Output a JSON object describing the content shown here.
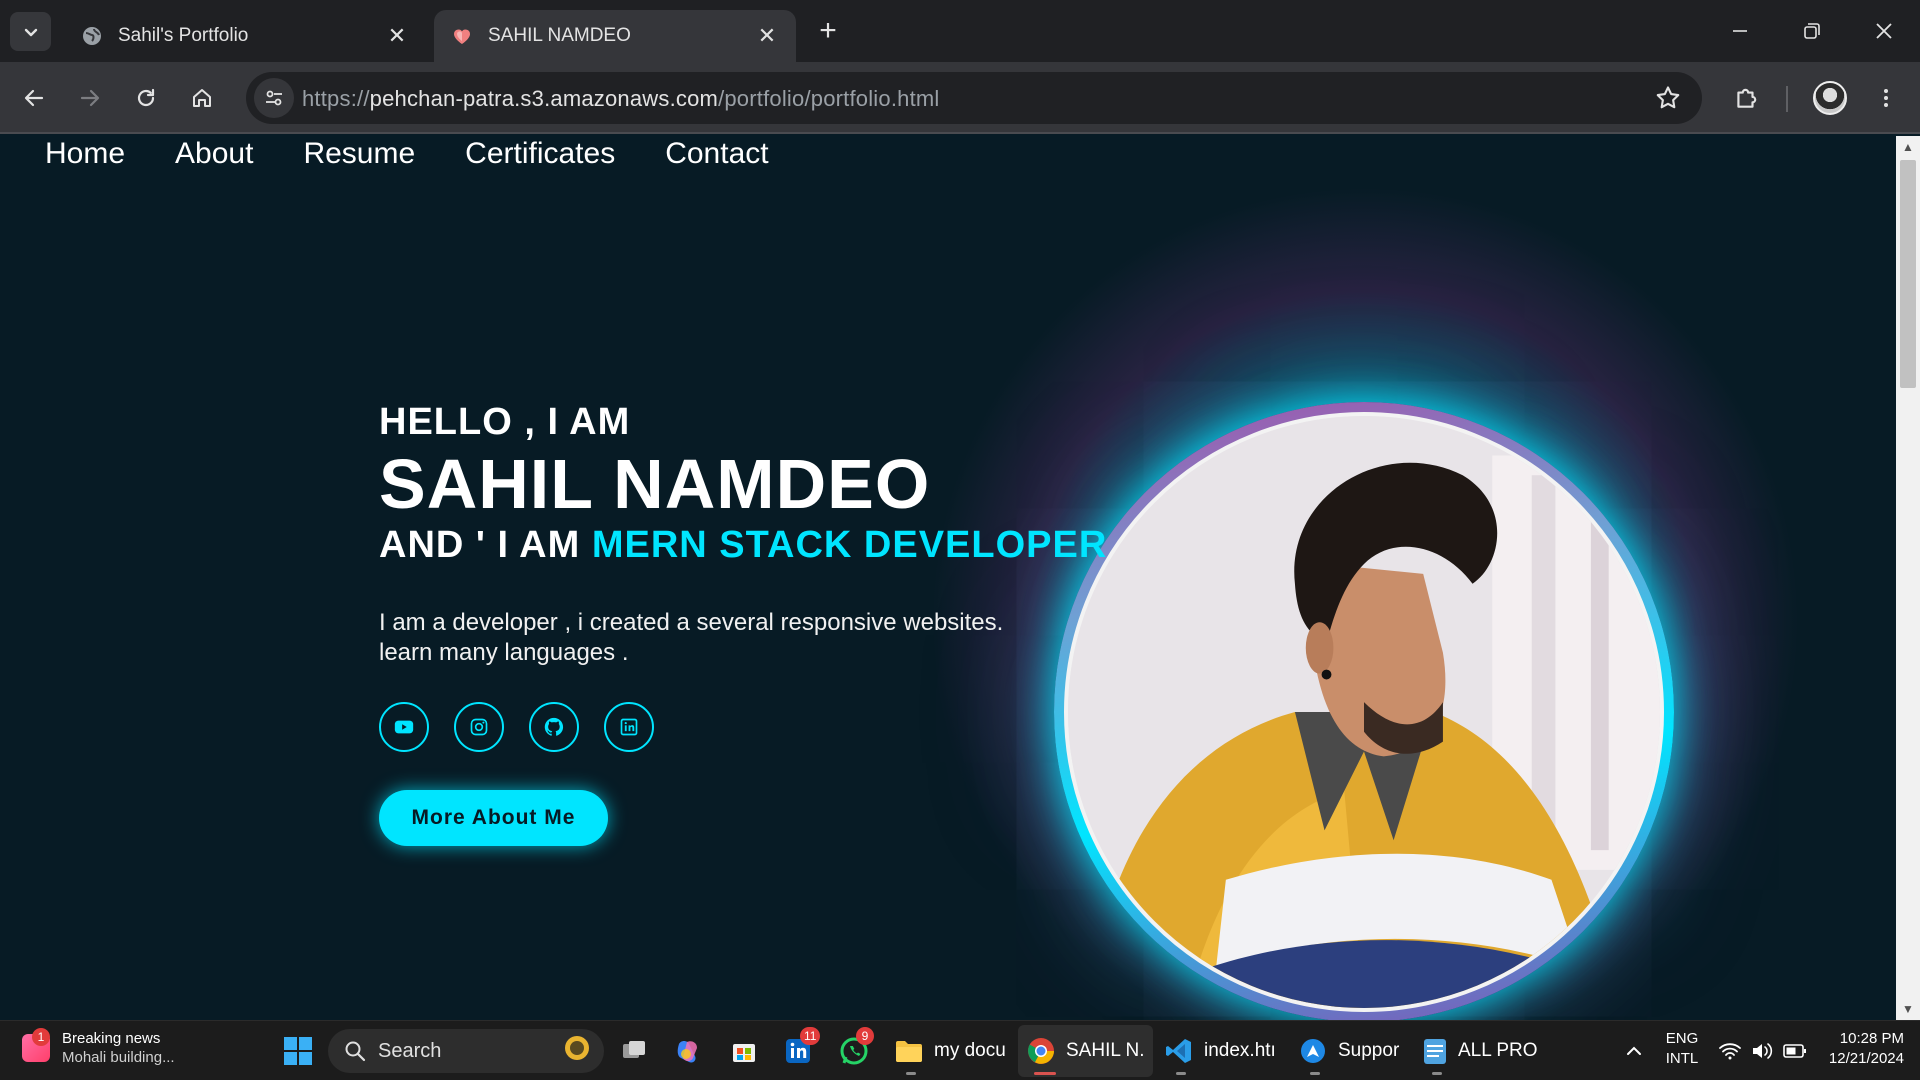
{
  "browser": {
    "tabs": [
      {
        "title": "Sahil's Portfolio",
        "active": false
      },
      {
        "title": "SAHIL NAMDEO",
        "active": true
      }
    ],
    "url_scheme_host": "https://",
    "url_host": "pehchan-patra.s3.amazonaws.com",
    "url_path": "/portfolio/portfolio.html"
  },
  "nav": {
    "items": [
      "Home",
      "About",
      "Resume",
      "Certificates",
      "Contact"
    ]
  },
  "hero": {
    "hello": "HELLO , I AM",
    "name": "SAHIL NAMDEO",
    "role_prefix": "AND ' I AM ",
    "role_accent": "MERN STACK DEVELOPER",
    "intro_line1": "I am a developer , i created a several responsive websites.",
    "intro_line2": "learn many languages .",
    "cta": "More About Me",
    "socials": [
      "youtube-icon",
      "instagram-icon",
      "github-icon",
      "linkedin-icon"
    ],
    "accent_color": "#00e5ff",
    "background_color": "#071b25"
  },
  "taskbar": {
    "news_title": "Breaking news",
    "news_sub": "Mohali building...",
    "news_badge": "1",
    "search_placeholder": "Search",
    "linkedin_badge": "11",
    "whatsapp_badge": "9",
    "apps": [
      {
        "label": "my docu"
      },
      {
        "label": "SAHIL N."
      },
      {
        "label": "index.htı"
      },
      {
        "label": "Suppor"
      },
      {
        "label": "ALL PRO"
      }
    ],
    "lang_top": "ENG",
    "lang_bottom": "INTL",
    "time": "10:28 PM",
    "date": "12/21/2024"
  }
}
